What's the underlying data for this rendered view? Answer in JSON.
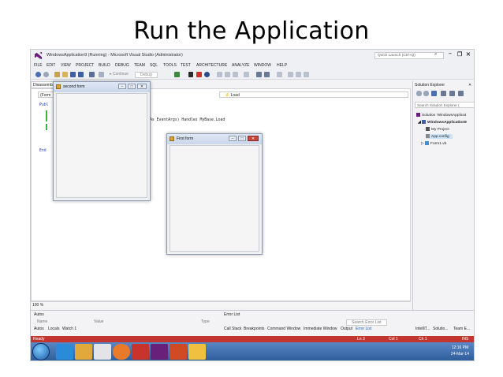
{
  "slide": {
    "title": "Run the Application"
  },
  "window": {
    "title": "WindowsApplication9 (Running) - Microsoft Visual Studio (Administrator)",
    "quick_launch_placeholder": "Quick Launch (Ctrl+Q)",
    "minimize": "–",
    "restore": "❐",
    "close": "✕"
  },
  "menu": [
    "FILE",
    "EDIT",
    "VIEW",
    "PROJECT",
    "BUILD",
    "DEBUG",
    "TEAM",
    "SQL",
    "TOOLS",
    "TEST",
    "ARCHITECTURE",
    "ANALYZE",
    "WINDOW",
    "HELP"
  ],
  "toolbar": {
    "continue": "▸ Continue",
    "debug": "Debug"
  },
  "editor": {
    "doc_tab": "Disassembly",
    "nav_left": "(Form",
    "nav_right": "⚡ Load",
    "line_pub": "Publ",
    "handler_text": "As EventArgs) Handles MyBase.Load",
    "end_text": "End",
    "zoom": "100 %"
  },
  "second_form": {
    "title": "second form"
  },
  "first_form": {
    "title": "First form"
  },
  "solution_explorer": {
    "title": "Solution Explorer",
    "search_placeholder": "Search Solution Explorer (",
    "items": [
      {
        "label": "Solution 'WindowsApplicat"
      },
      {
        "label": "WindowsApplication9"
      },
      {
        "label": "My Project"
      },
      {
        "label": "App.config"
      },
      {
        "label": "Form1.vb"
      }
    ]
  },
  "bottom": {
    "autos_title": "Autos",
    "error_list_title": "Error List",
    "name_col": "Name",
    "value_col": "Value",
    "type_col": "Type",
    "left_tabs": [
      "Autos",
      "Locals",
      "Watch 1"
    ],
    "right_tabs": [
      "Call Stack",
      "Breakpoints",
      "Command Window",
      "Immediate Window",
      "Output",
      "Error List"
    ],
    "search_error_list": "Search Error List",
    "far_tabs": [
      "IntelliT...",
      "Solutio...",
      "Team E..."
    ]
  },
  "status": {
    "ready": "Ready",
    "ln": "Ln 3",
    "col": "Col 1",
    "ch": "Ch 1",
    "ins": "INS"
  },
  "taskbar": {
    "time": "12:16 PM",
    "date": "24-Mar-14"
  },
  "colors": {
    "status_bar": "#c3362f",
    "vs_purple": "#68217a",
    "taskbar": "#2c5a98"
  }
}
